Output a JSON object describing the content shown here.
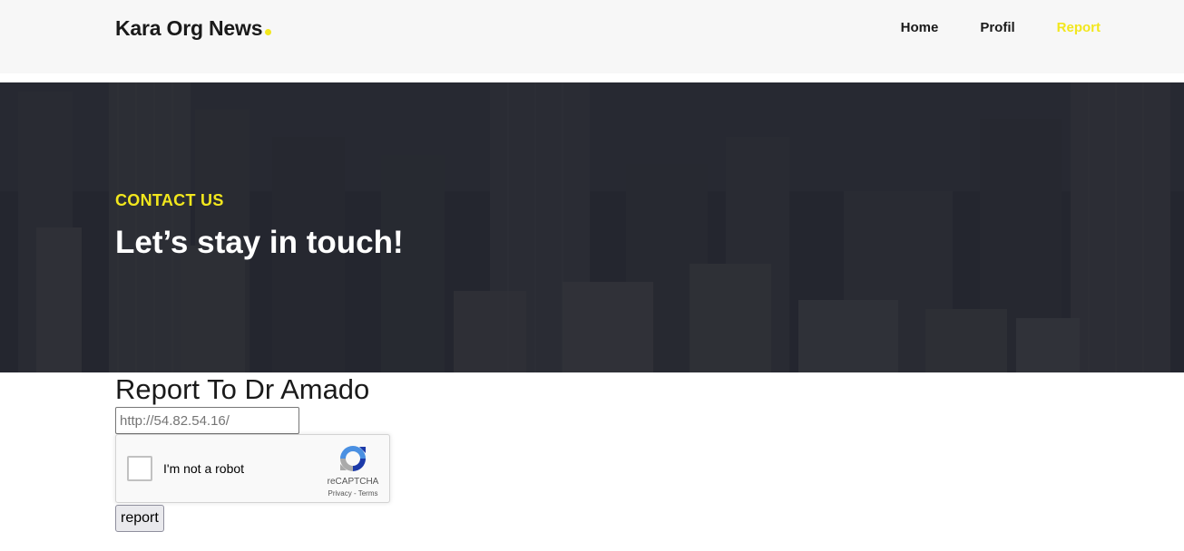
{
  "header": {
    "brand": "Kara Org News",
    "nav": [
      {
        "label": "Home"
      },
      {
        "label": "Profil"
      },
      {
        "label": "Report"
      }
    ]
  },
  "hero": {
    "kicker": "CONTACT US",
    "title": "Let’s stay in touch!"
  },
  "report": {
    "title": "Report To Dr Amado",
    "url_placeholder": "http://54.82.54.16/",
    "url_value": "",
    "captcha": {
      "label": "I'm not a robot",
      "brand": "reCAPTCHA",
      "privacy": "Privacy",
      "separator": " - ",
      "terms": "Terms"
    },
    "button_label": "report"
  },
  "colors": {
    "accent": "#f2e71d",
    "header_bg": "#f7f7f7",
    "hero_bg": "#2a2c33"
  }
}
